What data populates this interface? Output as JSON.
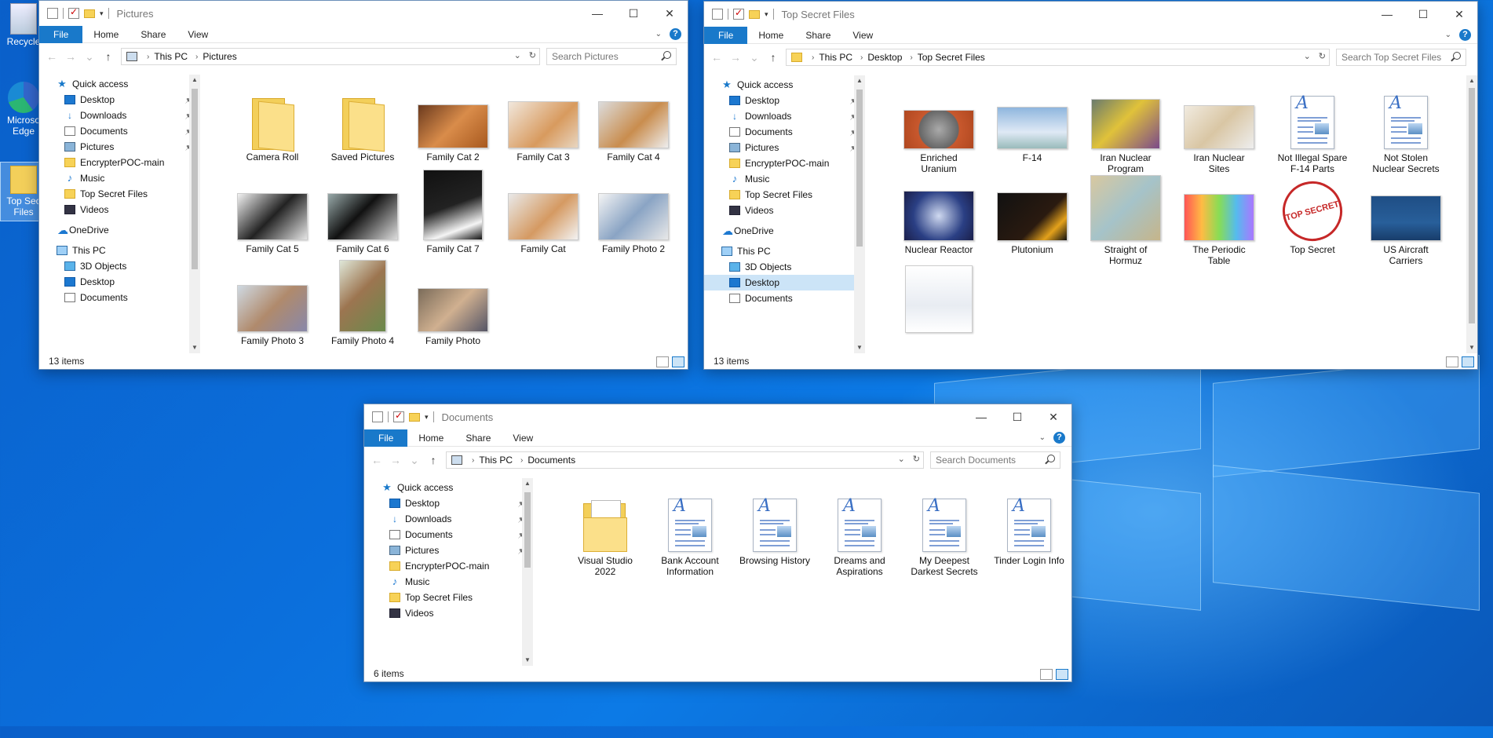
{
  "desktop": {
    "icons": [
      {
        "label": "Recycle"
      },
      {
        "label": "Microsoft Edge",
        "short": "Microso Edge"
      },
      {
        "label": "Top Secret Files",
        "short": "Top Sec Files"
      }
    ]
  },
  "windows": [
    {
      "id": "pictures",
      "title": "Pictures",
      "ribbon": {
        "file": "File",
        "home": "Home",
        "share": "Share",
        "view": "View"
      },
      "breadcrumb": [
        "This PC",
        "Pictures"
      ],
      "search_placeholder": "Search Pictures",
      "status": "13 items",
      "nav": [
        {
          "label": "Quick access",
          "icon": "star"
        },
        {
          "label": "Desktop",
          "icon": "desktop",
          "pinned": true
        },
        {
          "label": "Downloads",
          "icon": "download",
          "pinned": true
        },
        {
          "label": "Documents",
          "icon": "documents",
          "pinned": true
        },
        {
          "label": "Pictures",
          "icon": "pictures",
          "pinned": true
        },
        {
          "label": "EncrypterPOC-main",
          "icon": "folder"
        },
        {
          "label": "Music",
          "icon": "music"
        },
        {
          "label": "Top Secret Files",
          "icon": "folder"
        },
        {
          "label": "Videos",
          "icon": "videos"
        },
        {
          "label": "OneDrive",
          "icon": "cloud"
        },
        {
          "label": "This PC",
          "icon": "pc"
        },
        {
          "label": "3D Objects",
          "icon": "3d"
        },
        {
          "label": "Desktop",
          "icon": "desktop"
        },
        {
          "label": "Documents",
          "icon": "documents"
        }
      ],
      "items": [
        {
          "label": "Camera Roll",
          "kind": "folder"
        },
        {
          "label": "Saved Pictures",
          "kind": "folder"
        },
        {
          "label": "Family Cat 2",
          "kind": "photo",
          "style": "p-cat1"
        },
        {
          "label": "Family Cat 3",
          "kind": "photo",
          "style": "p-cat2"
        },
        {
          "label": "Family Cat 4",
          "kind": "photo",
          "style": "p-cat3"
        },
        {
          "label": "Family Cat 5",
          "kind": "photo",
          "style": "p-bw"
        },
        {
          "label": "Family Cat 6",
          "kind": "photo",
          "style": "p-bw2"
        },
        {
          "label": "Family Cat 7",
          "kind": "photo",
          "style": "p-bw3"
        },
        {
          "label": "Family Cat",
          "kind": "photo",
          "style": "p-cat4"
        },
        {
          "label": "Family Photo 2",
          "kind": "photo",
          "style": "p-fam"
        },
        {
          "label": "Family Photo 3",
          "kind": "photo",
          "style": "p-fam2"
        },
        {
          "label": "Family Photo 4",
          "kind": "photo",
          "style": "p-fam3"
        },
        {
          "label": "Family Photo",
          "kind": "photo",
          "style": "p-fam4"
        }
      ]
    },
    {
      "id": "topsecret",
      "title": "Top Secret Files",
      "ribbon": {
        "file": "File",
        "home": "Home",
        "share": "Share",
        "view": "View"
      },
      "breadcrumb": [
        "This PC",
        "Desktop",
        "Top Secret Files"
      ],
      "search_placeholder": "Search Top Secret Files",
      "status": "13 items",
      "nav": [
        {
          "label": "Quick access",
          "icon": "star"
        },
        {
          "label": "Desktop",
          "icon": "desktop",
          "pinned": true
        },
        {
          "label": "Downloads",
          "icon": "download",
          "pinned": true
        },
        {
          "label": "Documents",
          "icon": "documents",
          "pinned": true
        },
        {
          "label": "Pictures",
          "icon": "pictures",
          "pinned": true
        },
        {
          "label": "EncrypterPOC-main",
          "icon": "folder"
        },
        {
          "label": "Music",
          "icon": "music"
        },
        {
          "label": "Top Secret Files",
          "icon": "folder"
        },
        {
          "label": "Videos",
          "icon": "videos"
        },
        {
          "label": "OneDrive",
          "icon": "cloud"
        },
        {
          "label": "This PC",
          "icon": "pc"
        },
        {
          "label": "3D Objects",
          "icon": "3d"
        },
        {
          "label": "Desktop",
          "icon": "desktop",
          "selected": true
        },
        {
          "label": "Documents",
          "icon": "documents"
        }
      ],
      "items": [
        {
          "label": "Enriched Uranium",
          "kind": "photo",
          "style": "p-uran"
        },
        {
          "label": "F-14",
          "kind": "photo",
          "style": "p-f14"
        },
        {
          "label": "Iran Nuclear Program",
          "kind": "photo",
          "style": "p-iran"
        },
        {
          "label": "Iran Nuclear Sites",
          "kind": "photo",
          "style": "p-sites"
        },
        {
          "label": "Not Illegal Spare F-14 Parts",
          "kind": "doc"
        },
        {
          "label": "Not Stolen Nuclear Secrets",
          "kind": "doc"
        },
        {
          "label": "Nuclear Reactor",
          "kind": "photo",
          "style": "p-reac"
        },
        {
          "label": "Plutonium",
          "kind": "photo",
          "style": "p-plu"
        },
        {
          "label": "Straight of Hormuz",
          "kind": "photo",
          "style": "p-hormuz"
        },
        {
          "label": "The Periodic Table",
          "kind": "photo",
          "style": "p-periodic"
        },
        {
          "label": "Top Secret",
          "kind": "stamp",
          "stamp_text": "TOP SECRET"
        },
        {
          "label": "US Aircraft Carriers",
          "kind": "photo",
          "style": "p-carriers"
        },
        {
          "label": "",
          "kind": "photo",
          "style": "p-coat"
        }
      ]
    },
    {
      "id": "documents",
      "title": "Documents",
      "ribbon": {
        "file": "File",
        "home": "Home",
        "share": "Share",
        "view": "View"
      },
      "breadcrumb": [
        "This PC",
        "Documents"
      ],
      "search_placeholder": "Search Documents",
      "status": "6 items",
      "nav": [
        {
          "label": "Quick access",
          "icon": "star"
        },
        {
          "label": "Desktop",
          "icon": "desktop",
          "pinned": true
        },
        {
          "label": "Downloads",
          "icon": "download",
          "pinned": true
        },
        {
          "label": "Documents",
          "icon": "documents",
          "pinned": true
        },
        {
          "label": "Pictures",
          "icon": "pictures",
          "pinned": true
        },
        {
          "label": "EncrypterPOC-main",
          "icon": "folder"
        },
        {
          "label": "Music",
          "icon": "music"
        },
        {
          "label": "Top Secret Files",
          "icon": "folder"
        },
        {
          "label": "Videos",
          "icon": "videos"
        }
      ],
      "items": [
        {
          "label": "Visual Studio 2022",
          "kind": "vsfolder"
        },
        {
          "label": "Bank Account Information",
          "kind": "doc"
        },
        {
          "label": "Browsing History",
          "kind": "doc"
        },
        {
          "label": "Dreams and Aspirations",
          "kind": "doc"
        },
        {
          "label": "My Deepest Darkest Secrets",
          "kind": "doc"
        },
        {
          "label": "Tinder Login Info",
          "kind": "doc"
        }
      ]
    }
  ]
}
